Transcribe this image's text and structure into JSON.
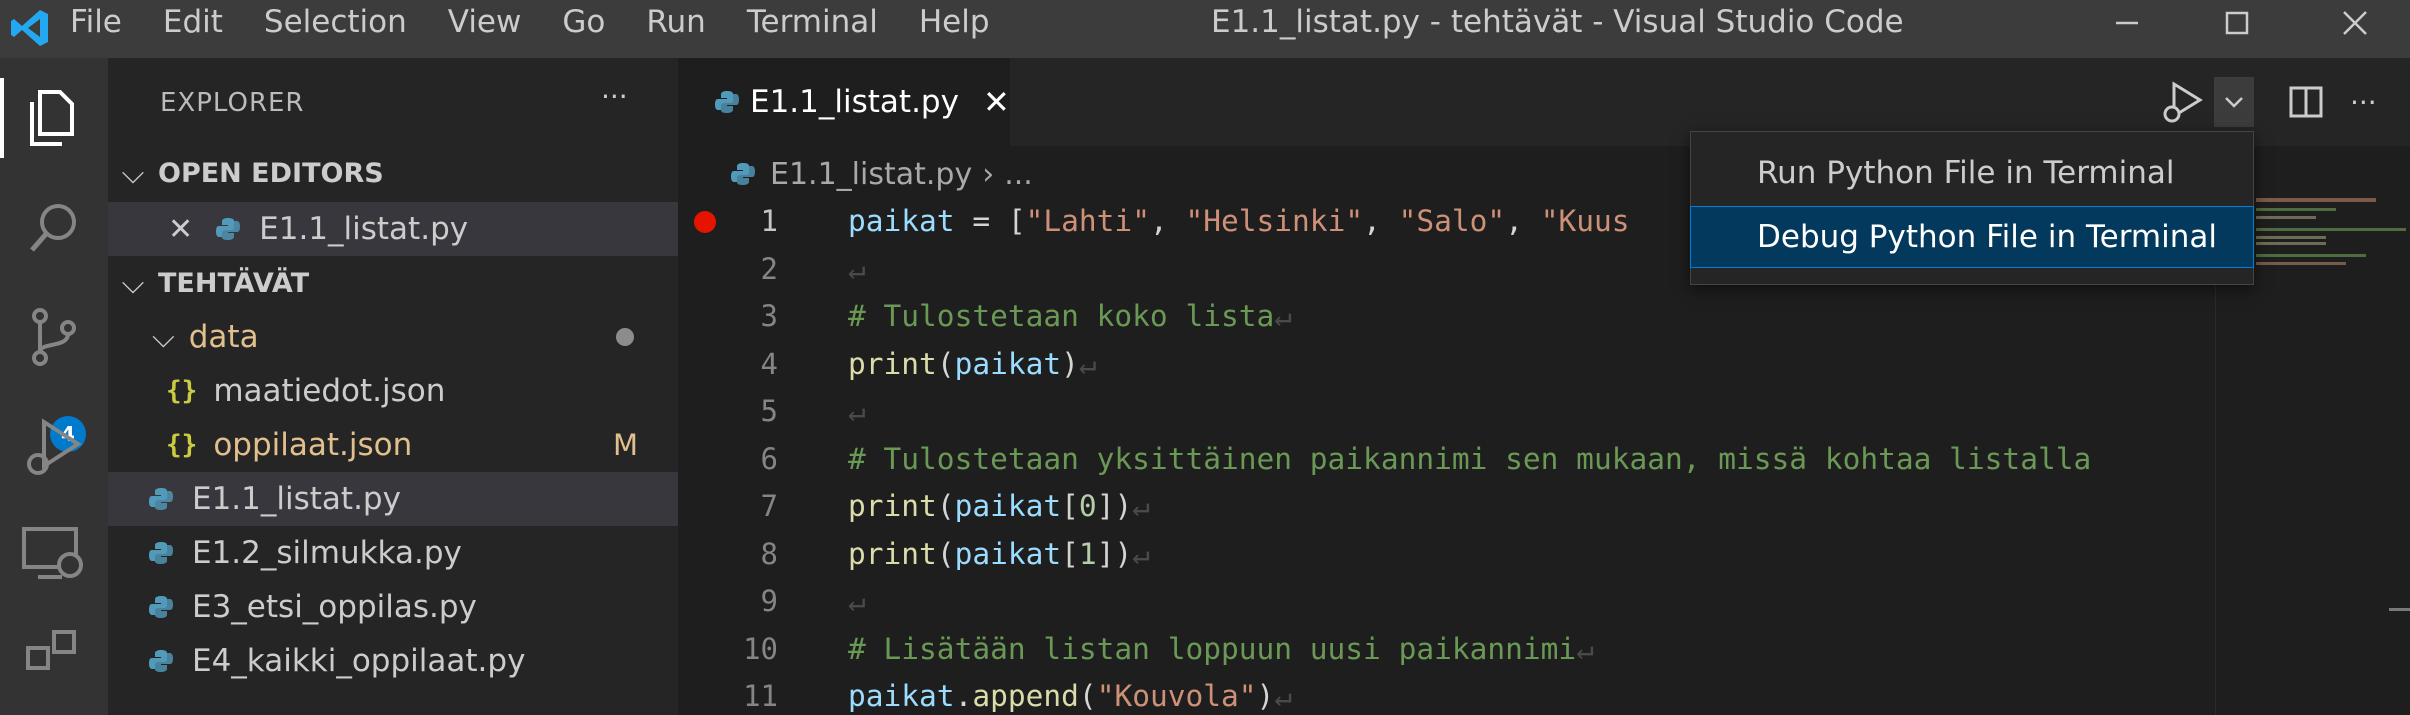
{
  "window": {
    "title": "E1.1_listat.py - tehtävät - Visual Studio Code",
    "menu": [
      "File",
      "Edit",
      "Selection",
      "View",
      "Go",
      "Run",
      "Terminal",
      "Help"
    ]
  },
  "activity_bar": {
    "icons": [
      "explorer-icon",
      "search-icon",
      "source-control-icon",
      "run-debug-icon",
      "remote-explorer-icon",
      "extensions-icon"
    ],
    "source_control_badge": "4"
  },
  "sidebar": {
    "title": "EXPLORER",
    "more": "···",
    "open_editors": {
      "header": "OPEN EDITORS",
      "files": [
        {
          "name": "E1.1_listat.py"
        }
      ]
    },
    "workspace": {
      "header": "TEHTÄVÄT",
      "folder": "data",
      "folder_files": [
        {
          "name": "maatiedot.json",
          "status": ""
        },
        {
          "name": "oppilaat.json",
          "status": "M"
        }
      ],
      "files": [
        "E1.1_listat.py",
        "E1.2_silmukka.py",
        "E3_etsi_oppilas.py",
        "E4_kaikki_oppilaat.py"
      ]
    }
  },
  "editor": {
    "tab_label": "E1.1_listat.py",
    "breadcrumb_file": "E1.1_listat.py",
    "breadcrumb_rest": "...",
    "line_numbers": [
      "1",
      "2",
      "3",
      "4",
      "5",
      "6",
      "7",
      "8",
      "9",
      "10",
      "11"
    ],
    "lines": {
      "l1_var": "paikat",
      "l1_op": " = [",
      "l1_s1": "\"Lahti\"",
      "l1_s2": "\"Helsinki\"",
      "l1_s3": "\"Salo\"",
      "l1_s4": "\"Kuus",
      "l3": "# Tulostetaan koko lista",
      "l4_fn": "print",
      "l4_var": "paikat",
      "l6": "# Tulostetaan yksittäinen paikannimi sen mukaan, missä kohtaa listalla",
      "l7_fn": "print",
      "l7_var": "paikat",
      "l7_num": "0",
      "l8_fn": "print",
      "l8_var": "paikat",
      "l8_num": "1",
      "l10": "# Lisätään listan loppuun uusi paikannimi",
      "l11_var": "paikat",
      "l11_fn": "append",
      "l11_str": "\"Kouvola\""
    },
    "eol_glyph": "↵"
  },
  "dropdown": {
    "items": [
      "Run Python File in Terminal",
      "Debug Python File in Terminal"
    ],
    "selected_index": 1
  },
  "colors": {
    "accent": "#007acc",
    "selection": "#04395e",
    "breakpoint": "#e51400",
    "modified": "#e2c08d"
  }
}
